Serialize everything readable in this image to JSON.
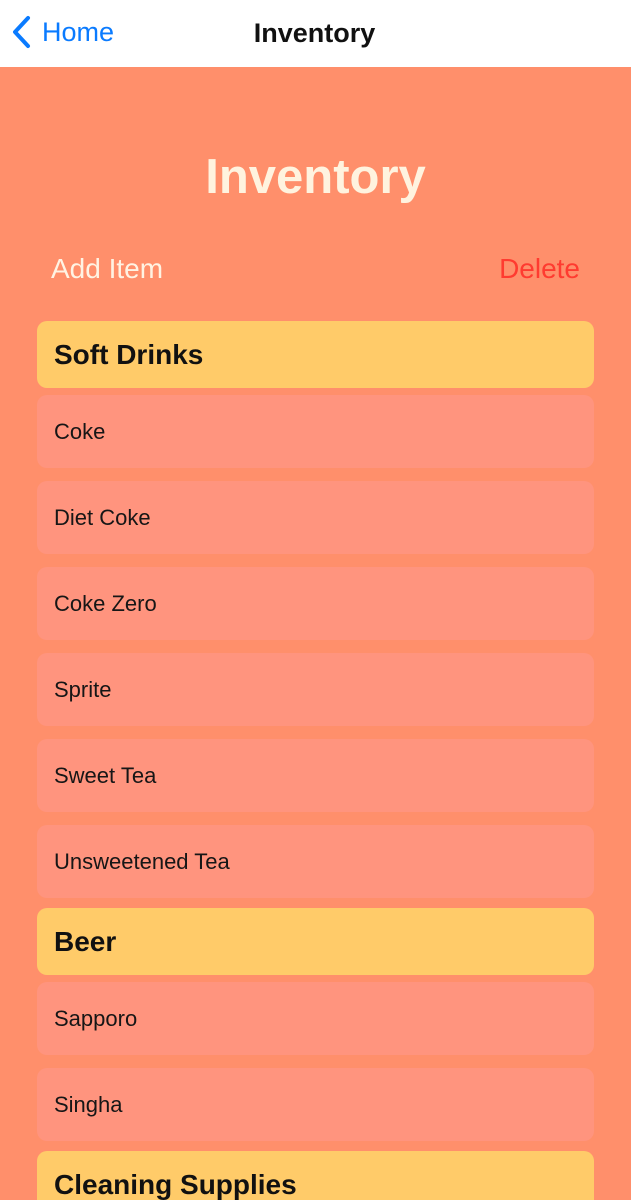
{
  "navbar": {
    "back_label": "Home",
    "title": "Inventory"
  },
  "page": {
    "title": "Inventory",
    "add_label": "Add Item",
    "delete_label": "Delete"
  },
  "sections": [
    {
      "title": "Soft Drinks",
      "items": [
        "Coke",
        "Diet Coke",
        "Coke Zero",
        "Sprite",
        "Sweet Tea",
        "Unsweetened Tea"
      ]
    },
    {
      "title": "Beer",
      "items": [
        "Sapporo",
        "Singha"
      ]
    },
    {
      "title": "Cleaning Supplies",
      "items": []
    }
  ],
  "colors": {
    "background": "#ff8f6b",
    "section_header": "#ffcb69",
    "row": "#ff947e",
    "accent_blue": "#0a7bff",
    "delete_red": "#ff3b30"
  },
  "icons": {
    "back": "chevron-left-icon"
  }
}
